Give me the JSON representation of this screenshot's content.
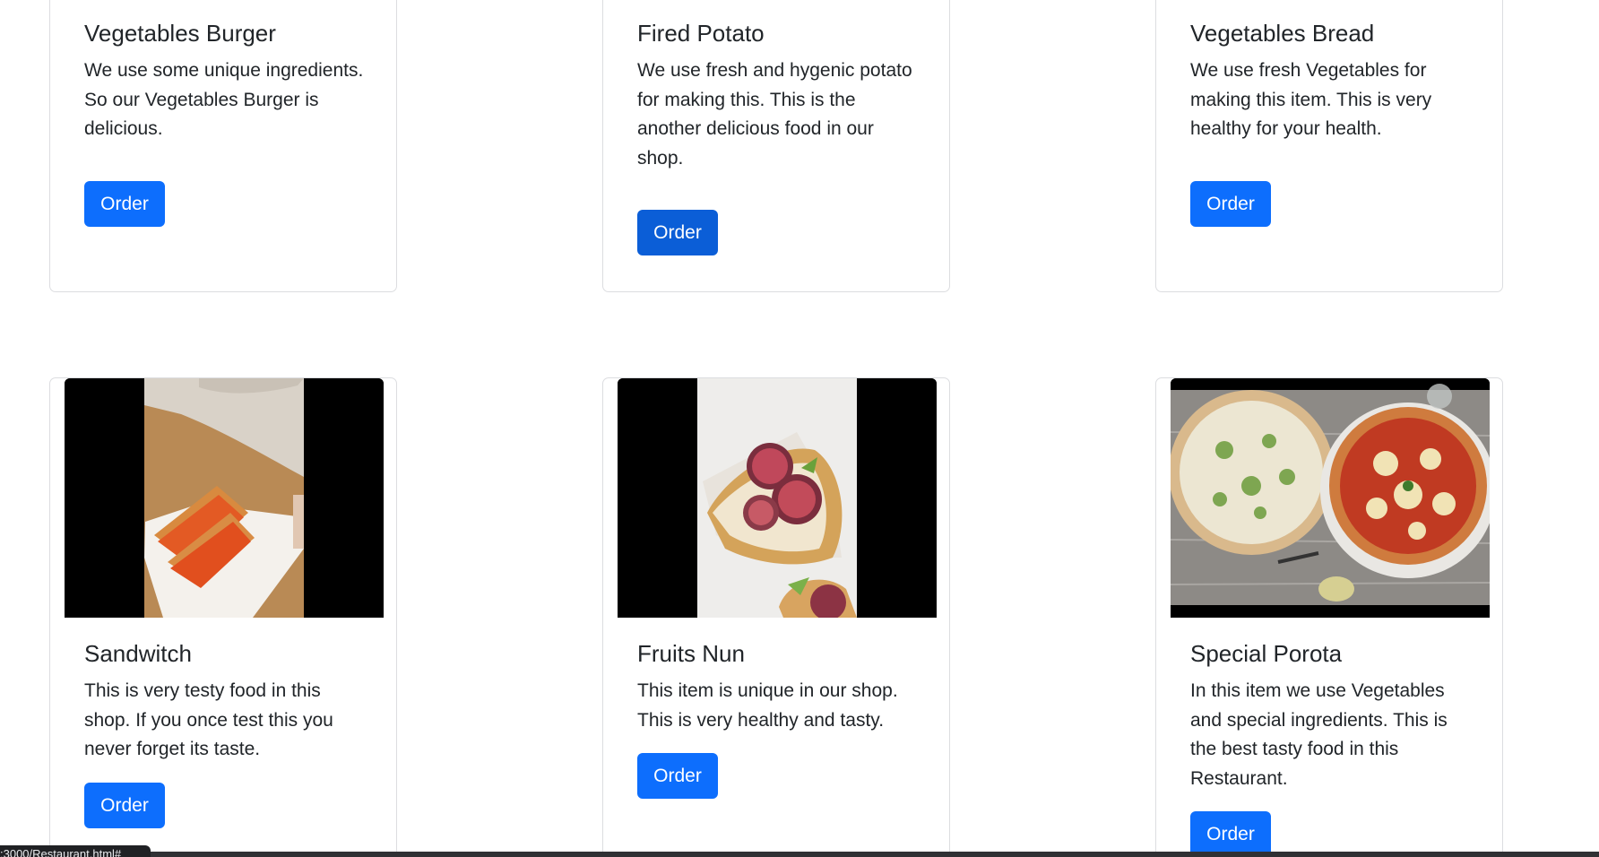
{
  "cards": [
    {
      "title": "Vegetables Burger",
      "text": "We use some unique ingredients. So our Vegetables Burger is delicious.",
      "button": "Order",
      "image_icon": "vegetables-burger-photo"
    },
    {
      "title": "Fired Potato",
      "text": "We use fresh and hygenic potato for making this. This is the another delicious food in our shop.",
      "button": "Order",
      "image_icon": "fried-potato-photo"
    },
    {
      "title": "Vegetables Bread",
      "text": "We use fresh Vegetables for making this item. This is very healthy for your health.",
      "button": "Order",
      "image_icon": "vegetables-bread-photo"
    },
    {
      "title": "Sandwitch",
      "text": "This is very testy food in this shop. If you once test this you never forget its taste.",
      "button": "Order",
      "image_icon": "sandwich-photo"
    },
    {
      "title": "Fruits Nun",
      "text": "This item is unique in our shop. This is very healthy and tasty.",
      "button": "Order",
      "image_icon": "fig-bread-photo"
    },
    {
      "title": "Special Porota",
      "text": "In this item we use Vegetables and special ingredients. This is the best tasty food in this Restaurant.",
      "button": "Order",
      "image_icon": "pizza-photo"
    }
  ],
  "status_bar": {
    "url": ":3000/Restaurant.html#"
  },
  "colors": {
    "button": "#0d6efd",
    "button_active": "#0b5ed7",
    "card_border": "#dcdde0"
  }
}
